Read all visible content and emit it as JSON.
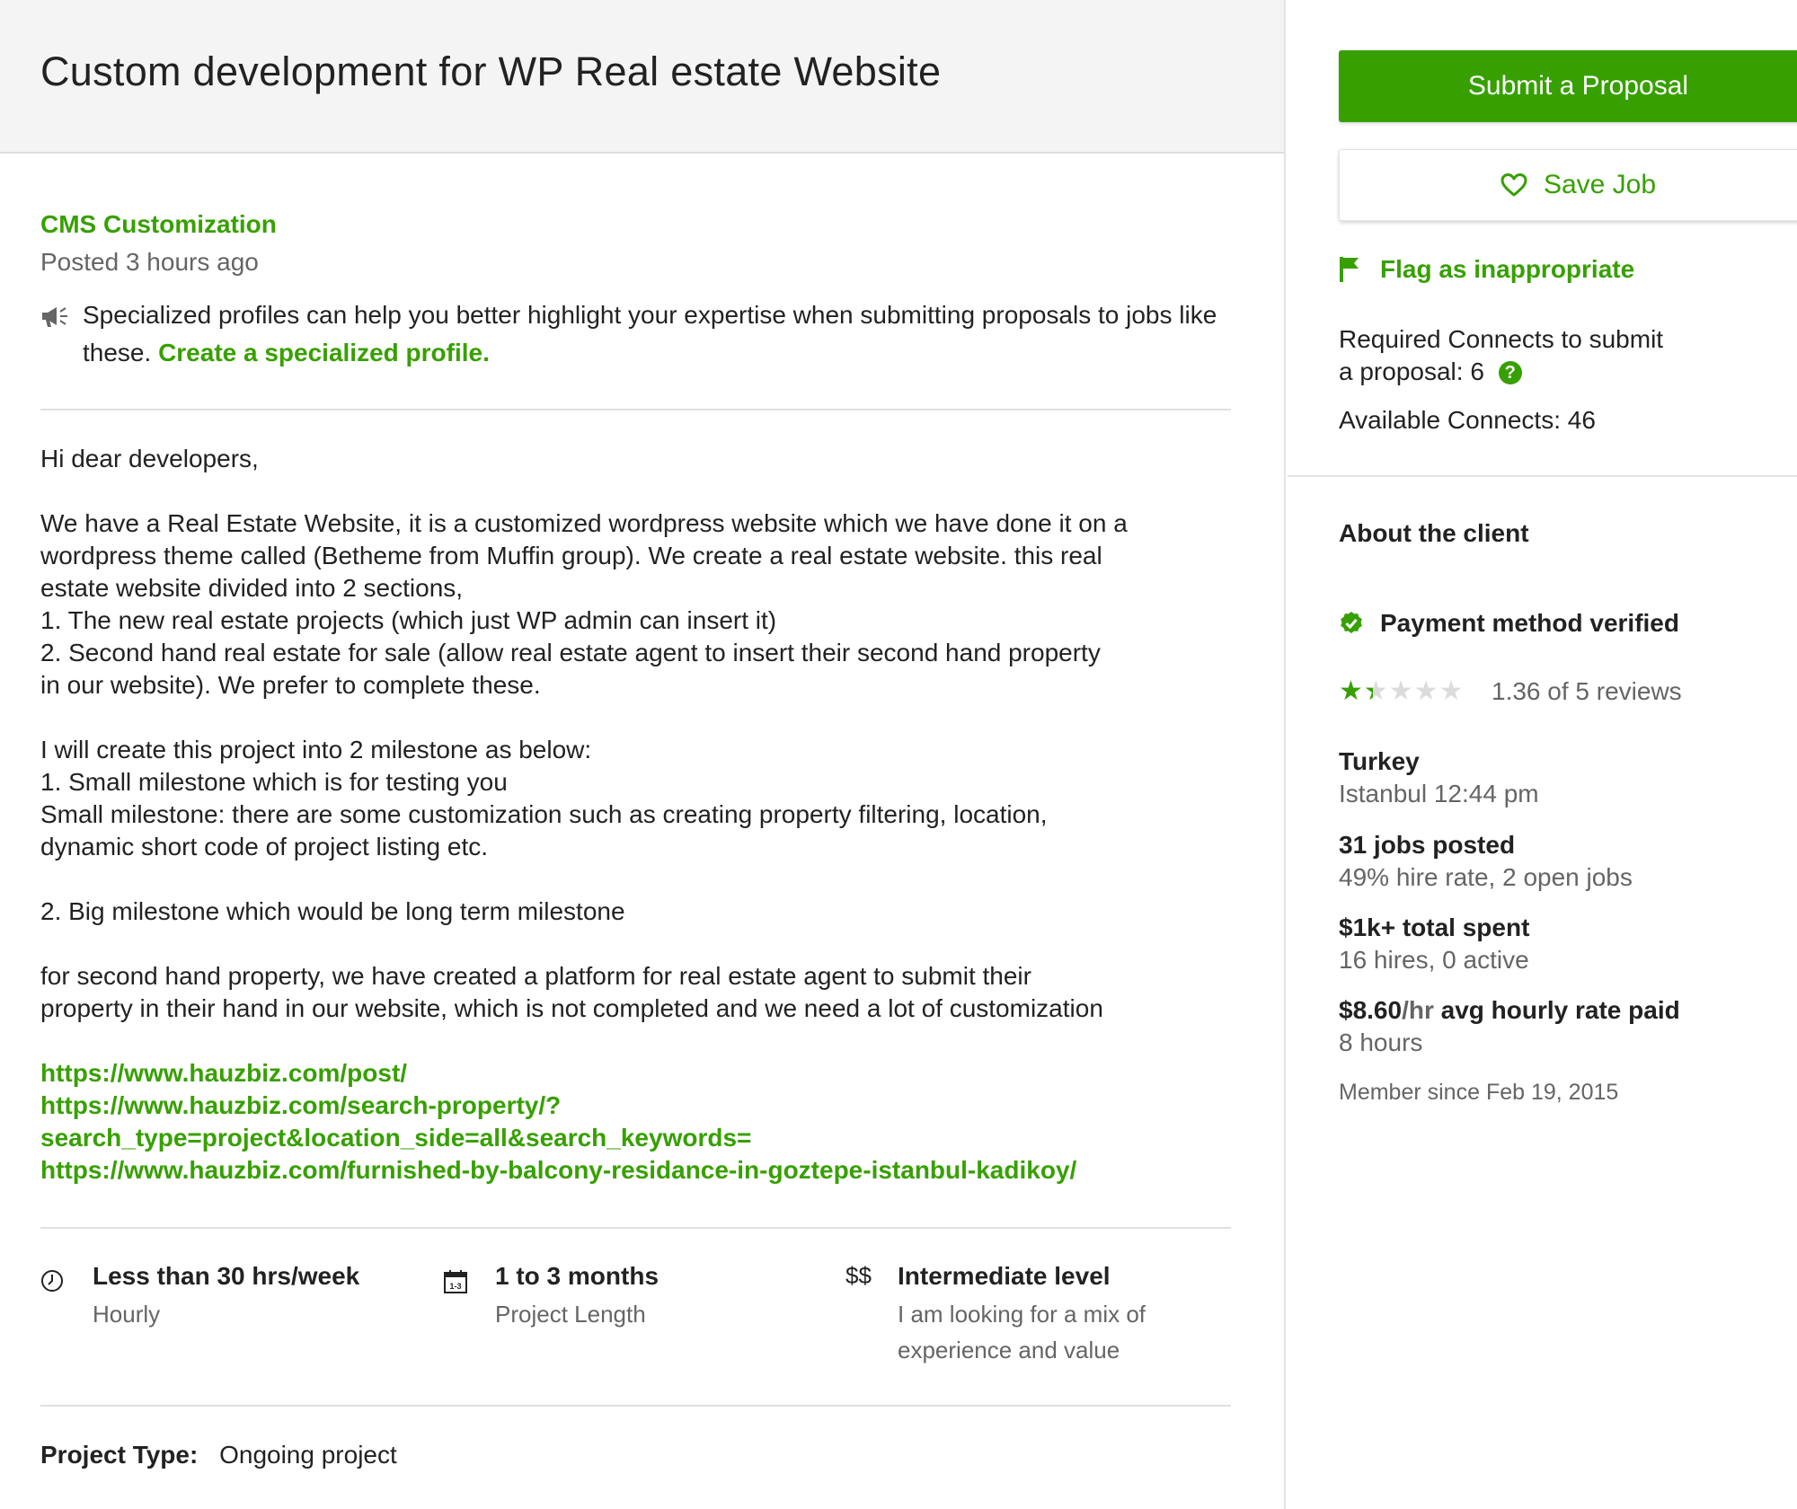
{
  "job": {
    "title": "Custom development for WP Real estate Website",
    "category": "CMS Customization",
    "posted": "Posted 3 hours ago"
  },
  "tip": {
    "text": "Specialized profiles can help you better highlight your expertise when submitting proposals to jobs like these.",
    "link": "Create a specialized profile."
  },
  "description": {
    "p1": "Hi dear developers,",
    "p2": [
      "We have a Real Estate Website, it is a customized wordpress website which we have done it on a",
      "wordpress theme called (Betheme from Muffin group). We create a real estate website. this real",
      "estate website divided into 2 sections,",
      "1. The new real estate projects (which just WP admin can insert it)",
      "2. Second hand real estate for sale (allow real estate agent to insert their second hand property",
      "in our website). We prefer to complete these."
    ],
    "p3": [
      "I will create this project into 2 milestone as below:",
      "1. Small milestone which is for testing you",
      "Small milestone: there are some customization such as creating property filtering, location,",
      "dynamic short code of project listing etc."
    ],
    "p4": "2. Big milestone which would be long term milestone",
    "p5": [
      "for second hand property, we have created a platform for real estate agent to submit their",
      "property in their hand in our website, which is not completed and we need a lot of customization"
    ],
    "links": [
      "https://www.hauzbiz.com/post/",
      "https://www.hauzbiz.com/search-property/?",
      "search_type=project&location_side=all&search_keywords=",
      "https://www.hauzbiz.com/furnished-by-balcony-residance-in-goztepe-istanbul-kadikoy/"
    ]
  },
  "facts": {
    "hours": {
      "title": "Less than 30 hrs/week",
      "sub": "Hourly"
    },
    "length": {
      "title": "1 to 3 months",
      "sub": "Project Length",
      "icon_text": "1-3"
    },
    "level": {
      "icon_text": "$$",
      "title": "Intermediate level",
      "sub1": "I am looking for a mix of",
      "sub2": "experience and value"
    }
  },
  "project_type": {
    "label": "Project Type:",
    "value": "Ongoing project"
  },
  "sidebar": {
    "submit_label": "Submit a Proposal",
    "save_label": "Save Job",
    "flag_label": "Flag as inappropriate",
    "connects_required_line1": "Required Connects to submit",
    "connects_required_line2": "a proposal: 6",
    "connects_help": "?",
    "available_connects": "Available Connects: 46"
  },
  "client": {
    "heading": "About the client",
    "payment": "Payment method verified",
    "rating": 1.36,
    "rating_text": "1.36 of 5 reviews",
    "country": "Turkey",
    "city_time": "Istanbul 12:44 pm",
    "jobs_posted": "31 jobs posted",
    "hire_rate": "49% hire rate, 2 open jobs",
    "total_spent": "$1k+ total spent",
    "hires": "16 hires, 0 active",
    "rate_value": "$8.60",
    "rate_unit": "/hr",
    "rate_label": " avg hourly rate paid",
    "hours": "8 hours",
    "member_since": "Member since Feb 19, 2015"
  },
  "colors": {
    "accent": "#37a000",
    "muted": "#656565",
    "text": "#222222",
    "header_bg": "#f4f4f4"
  },
  "icons": [
    "megaphone-icon",
    "heart-icon",
    "flag-icon",
    "question-icon",
    "check-circle-icon",
    "star-icon",
    "clock-icon",
    "calendar-icon"
  ]
}
